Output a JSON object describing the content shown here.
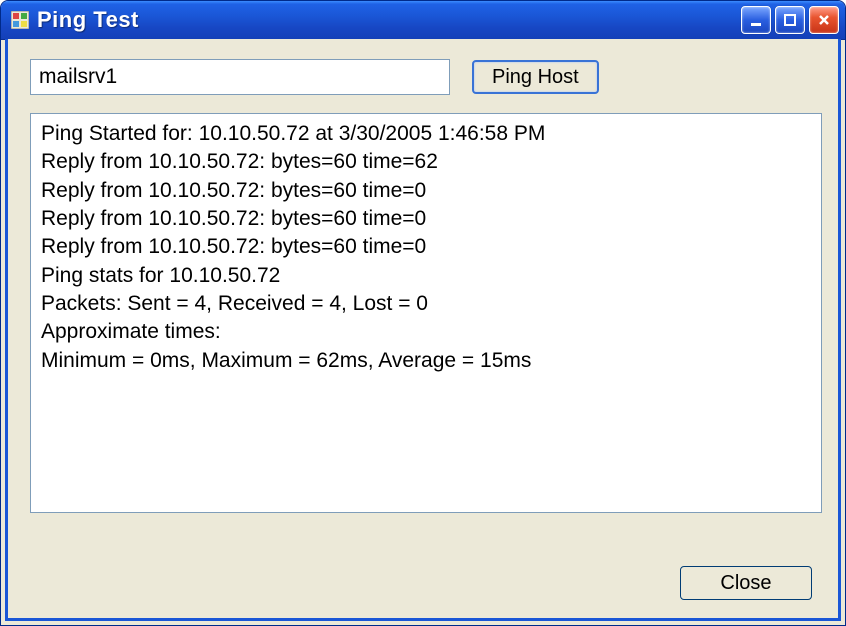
{
  "window": {
    "title": "Ping Test"
  },
  "controls": {
    "minimize_tooltip": "Minimize",
    "maximize_tooltip": "Maximize",
    "close_tooltip": "Close"
  },
  "form": {
    "host_value": "mailsrv1",
    "ping_button_label": "Ping Host",
    "close_button_label": "Close"
  },
  "output": {
    "lines": [
      "Ping Started for: 10.10.50.72 at 3/30/2005 1:46:58 PM",
      "Reply from 10.10.50.72: bytes=60 time=62",
      "Reply from 10.10.50.72: bytes=60 time=0",
      "Reply from 10.10.50.72: bytes=60 time=0",
      "Reply from 10.10.50.72: bytes=60 time=0",
      "Ping stats for 10.10.50.72",
      "Packets: Sent = 4, Received = 4, Lost = 0",
      "Approximate times:",
      "Minimum = 0ms, Maximum = 62ms, Average = 15ms"
    ]
  }
}
